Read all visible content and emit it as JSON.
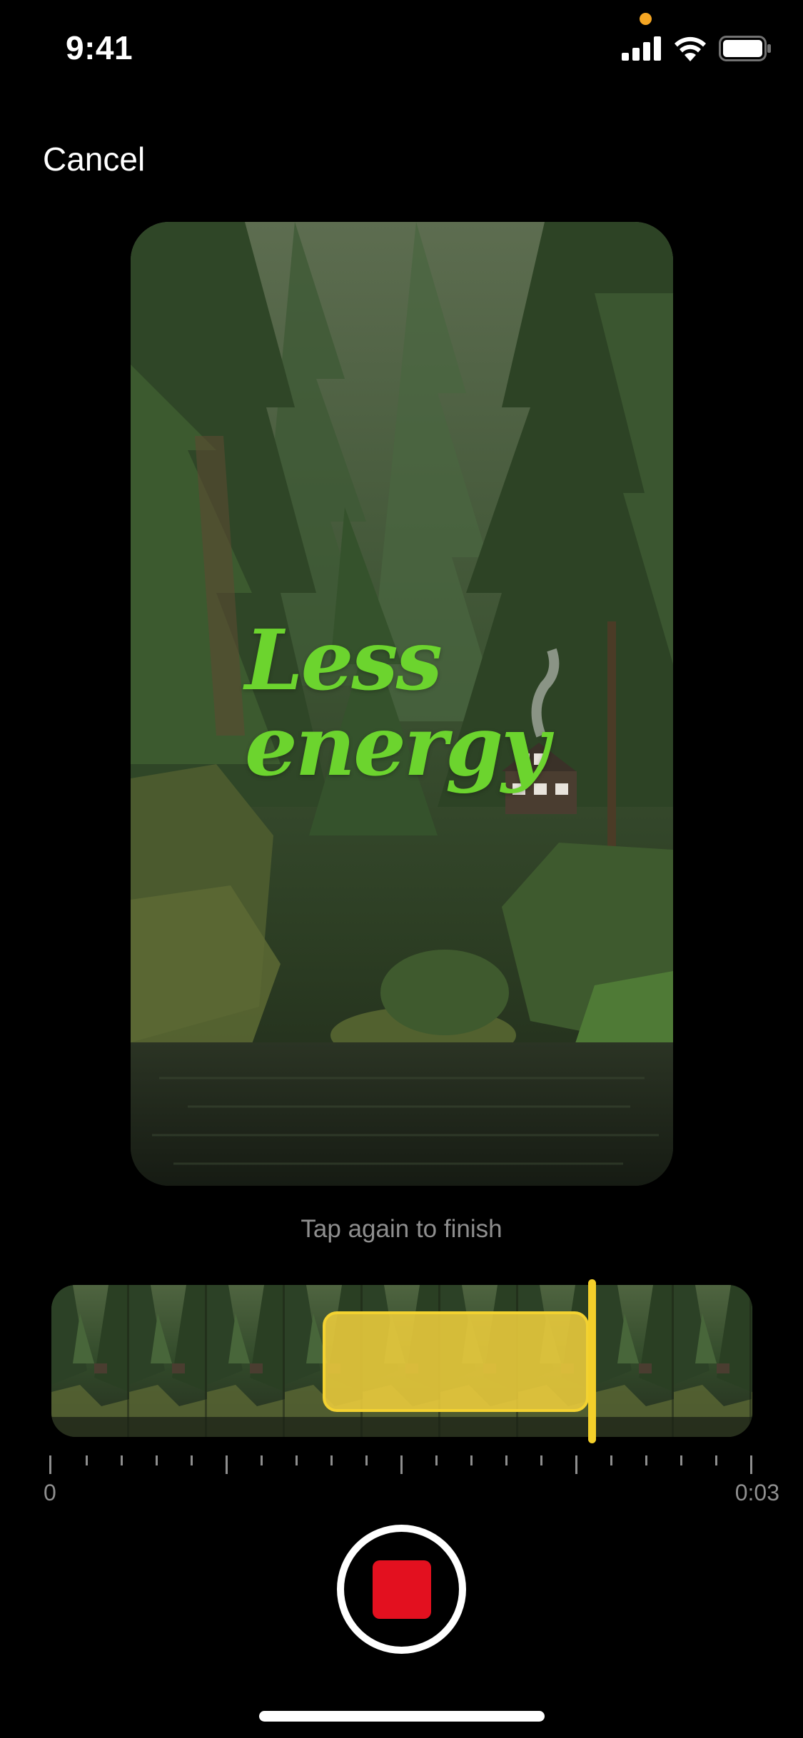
{
  "status_bar": {
    "time": "9:41",
    "icons": [
      "cellular-signal-icon",
      "wifi-icon",
      "battery-icon"
    ],
    "privacy_indicator_color": "#f5a623"
  },
  "header": {
    "cancel_label": "Cancel"
  },
  "preview": {
    "overlay_text_line1": "Less",
    "overlay_text_line2": "energy",
    "overlay_text_color": "#6cd42e"
  },
  "hint": "Tap again to finish",
  "timeline": {
    "start_label": "0",
    "end_label": "0:03",
    "selection_color": "#f3d231",
    "playhead_color": "#f3cf2a"
  },
  "record_button": {
    "state": "recording",
    "stop_color": "#e3101f"
  }
}
